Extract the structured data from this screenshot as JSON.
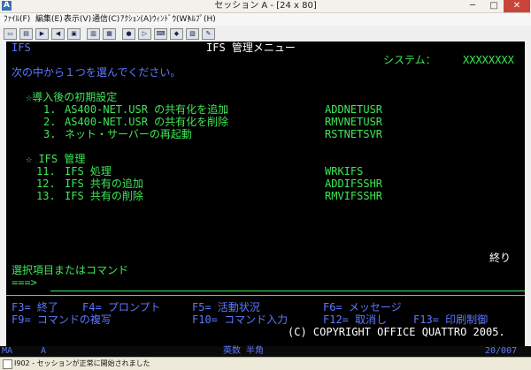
{
  "window": {
    "title": "セッション A - [24 x 80]",
    "min": "─",
    "max": "□",
    "close": "✕"
  },
  "menubar": [
    "ﾌｧｲﾙ(F)",
    "編集(E)",
    "表示(V)",
    "通信(C)",
    "ｱｸｼｮﾝ(A)",
    "ｳｨﾝﾄﾞｳ(W)",
    "ﾍﾙﾌﾟ(H)"
  ],
  "toolbar_icons": [
    "copy-icon",
    "paste-icon",
    "send-icon",
    "receive-icon",
    "display-icon",
    "print-icon",
    "screen-icon",
    "record-icon",
    "play-icon",
    "keyboard-icon",
    "color-icon",
    "map-icon",
    "macro-icon",
    "help-icon"
  ],
  "screen": {
    "system_id": "IFS",
    "title": "IFS 管理メニュー",
    "system_label": "システム：",
    "system_name": "XXXXXXXX",
    "instruction": "次の中から１つを選んでください。",
    "section1": {
      "heading": "☆導入後の初期設定",
      "items": [
        {
          "num": "1.",
          "label": "AS400-NET.USR の共有化を追加",
          "cmd": "ADDNETUSR"
        },
        {
          "num": "2.",
          "label": "AS400-NET.USR の共有化を削除",
          "cmd": "RMVNETUSR"
        },
        {
          "num": "3.",
          "label": "ネット・サーバーの再起動",
          "cmd": "RSTNETSVR"
        }
      ]
    },
    "section2": {
      "heading": "☆ IFS 管理",
      "items": [
        {
          "num": "11.",
          "label": "IFS 処理",
          "cmd": "WRKIFS"
        },
        {
          "num": "12.",
          "label": "IFS 共有の追加",
          "cmd": "ADDIFSSHR"
        },
        {
          "num": "13.",
          "label": "IFS 共有の削除",
          "cmd": "RMVIFSSHR"
        }
      ]
    },
    "end_label": "終り",
    "command_prompt": "選択項目またはコマンド",
    "command_arrow": "===>",
    "fkeys_row1": [
      "F3= 終了",
      "F4= プロンプト",
      "F5= 活動状況",
      "F6= メッセージ"
    ],
    "fkeys_row2": [
      "F9= コマンドの複写",
      "F10= コマンド入力",
      "F12= 取消し",
      "F13= 印刷制御"
    ],
    "copyright": "(C) COPYRIGHT OFFICE QUATTRO 2005."
  },
  "status_bar": {
    "ma": "MA",
    "session": "A",
    "input_mode": "英数 半角",
    "cursor": "20/007"
  },
  "message_bar": {
    "text": "I902 - セッションが正常に開始されました"
  },
  "colors": {
    "terminal_bg": "#000000",
    "blue": "#5e78ff",
    "green": "#3ee856",
    "white": "#ffffff"
  }
}
